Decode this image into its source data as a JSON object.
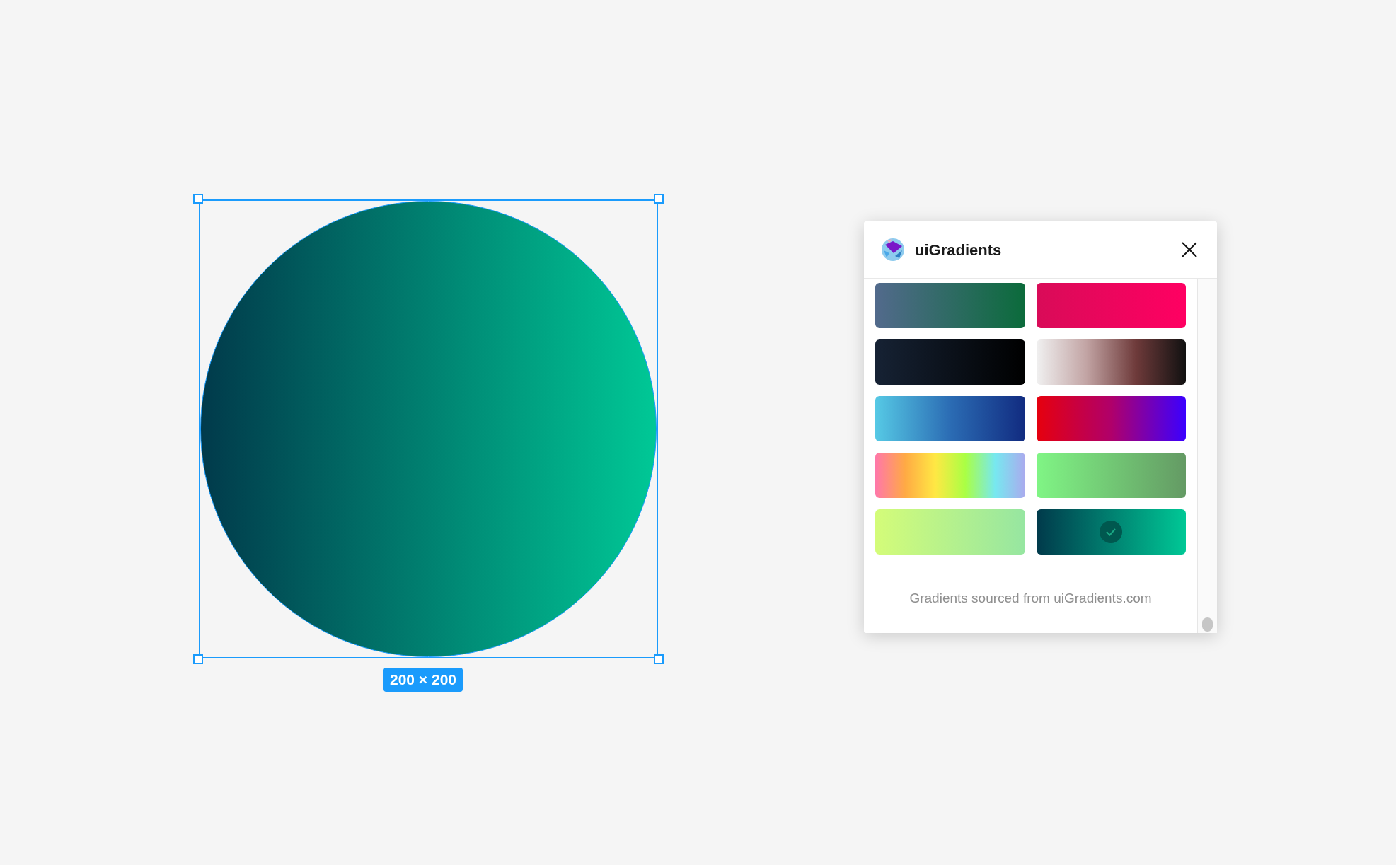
{
  "canvas": {
    "shape": {
      "size_label": "200 × 200"
    }
  },
  "plugin_panel": {
    "title": "uiGradients",
    "swatches": [
      {
        "selected": false
      },
      {
        "selected": false
      },
      {
        "selected": false
      },
      {
        "selected": false
      },
      {
        "selected": false
      },
      {
        "selected": false
      },
      {
        "selected": false
      },
      {
        "selected": false
      },
      {
        "selected": false
      },
      {
        "selected": true
      }
    ],
    "footer": "Gradients sourced from uiGradients.com"
  }
}
